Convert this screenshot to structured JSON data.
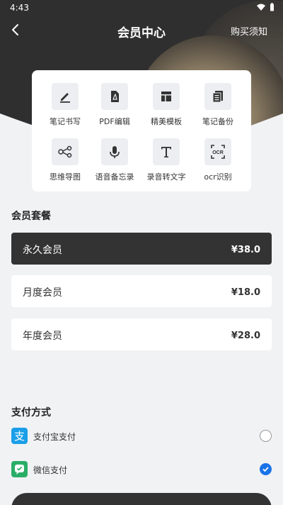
{
  "status_bar": {
    "time": "4:43"
  },
  "header": {
    "title": "会员中心",
    "notice_link": "购买须知"
  },
  "features": [
    {
      "label": "笔记书写",
      "icon": "pen-icon"
    },
    {
      "label": "PDF编辑",
      "icon": "pdf-icon"
    },
    {
      "label": "精美模板",
      "icon": "template-icon"
    },
    {
      "label": "笔记备份",
      "icon": "backup-icon"
    },
    {
      "label": "思维导图",
      "icon": "mindmap-icon"
    },
    {
      "label": "语音备忘录",
      "icon": "microphone-icon"
    },
    {
      "label": "录音转文字",
      "icon": "text-icon"
    },
    {
      "label": "ocr识别",
      "icon": "ocr-icon",
      "icon_text": "OCR"
    }
  ],
  "plans": {
    "title": "会员套餐",
    "items": [
      {
        "name": "永久会员",
        "price": "¥38.0",
        "selected": true
      },
      {
        "name": "月度会员",
        "price": "¥18.0",
        "selected": false
      },
      {
        "name": "年度会员",
        "price": "¥28.0",
        "selected": false
      }
    ]
  },
  "payment": {
    "title": "支付方式",
    "methods": [
      {
        "label": "支付宝支付",
        "icon": "alipay-icon",
        "icon_text": "支",
        "selected": false
      },
      {
        "label": "微信支付",
        "icon": "wechat-pay-icon",
        "selected": true
      }
    ]
  },
  "colors": {
    "header_dark": "#2f2f2f",
    "accent_gold": "#8a7b63",
    "selected_plan": "#333333",
    "radio_selected": "#1a73e8",
    "alipay": "#1a9fe8",
    "wechat": "#2aae67"
  }
}
